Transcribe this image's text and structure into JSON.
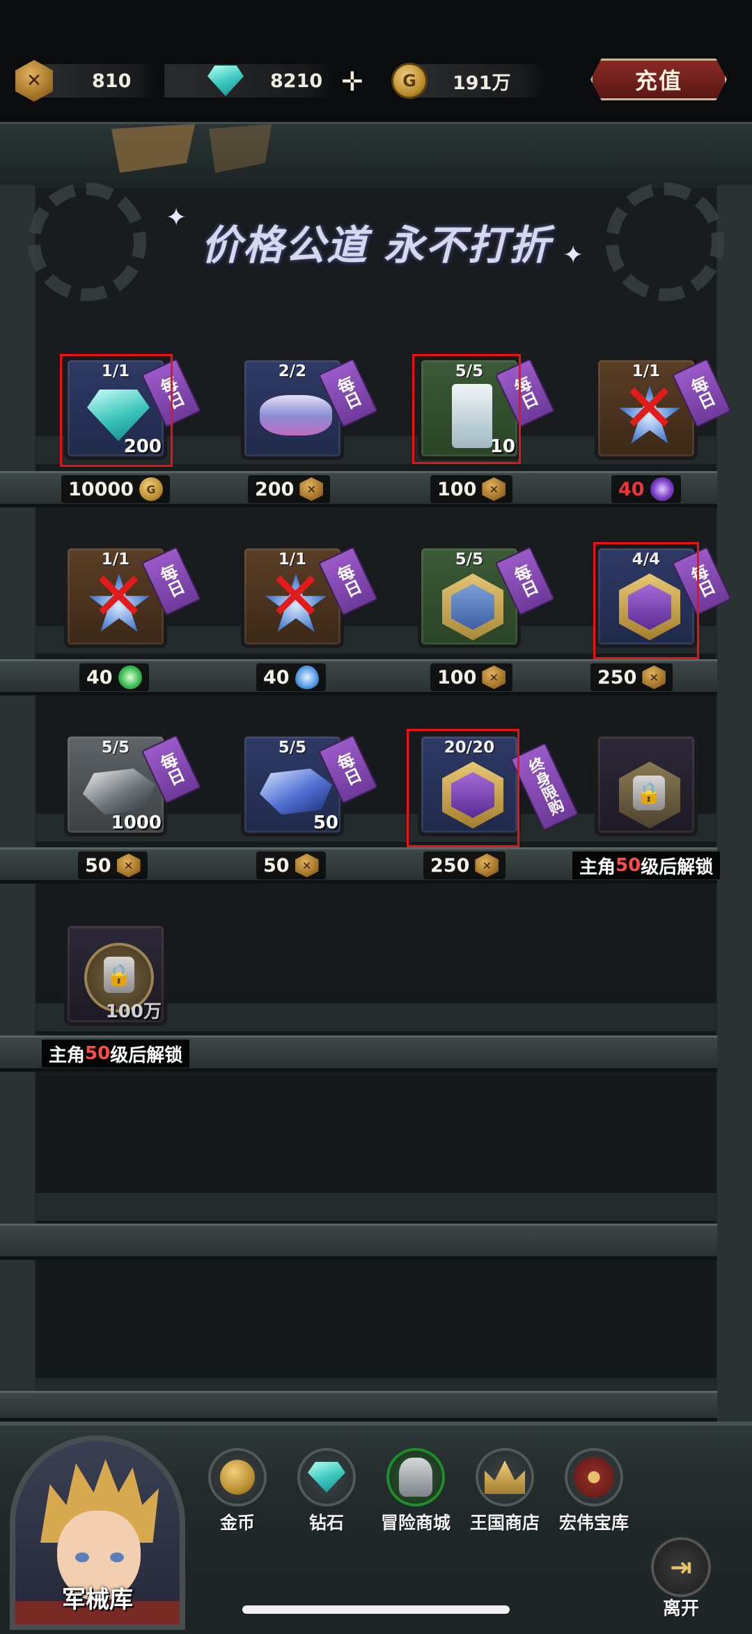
{
  "currencies": {
    "gold_token": {
      "icon": "gold-token-icon",
      "value": "810"
    },
    "diamond": {
      "icon": "diamond-icon",
      "value": "8210"
    },
    "coin": {
      "icon": "coin-icon",
      "value": "191万"
    }
  },
  "recharge_label": "充值",
  "slogan": "价格公道 永不打折",
  "items": [
    {
      "count": "1/1",
      "qty": "200",
      "tag": "每日",
      "icon": "diamond-icon",
      "price": "10000",
      "currency": "coin",
      "crossed": false,
      "highlighted": true,
      "frame": "f-blue"
    },
    {
      "count": "2/2",
      "qty": "",
      "tag": "每日",
      "icon": "mask-icon",
      "price": "200",
      "currency": "gold-token",
      "crossed": false,
      "highlighted": false,
      "frame": "f-blue"
    },
    {
      "count": "5/5",
      "qty": "10",
      "tag": "每日",
      "icon": "scroll-icon",
      "price": "100",
      "currency": "gold-token",
      "crossed": false,
      "highlighted": true,
      "frame": "f-green"
    },
    {
      "count": "1/1",
      "qty": "",
      "tag": "每日",
      "icon": "star-shard-icon",
      "price": "40",
      "currency": "vortex",
      "crossed": true,
      "highlighted": false,
      "frame": "f-brown",
      "price_red": true
    },
    {
      "count": "1/1",
      "qty": "",
      "tag": "每日",
      "icon": "star-shard-icon",
      "price": "40",
      "currency": "leaf",
      "crossed": true,
      "highlighted": false,
      "frame": "f-brown"
    },
    {
      "count": "1/1",
      "qty": "",
      "tag": "每日",
      "icon": "star-shard-icon",
      "price": "40",
      "currency": "drop",
      "crossed": true,
      "highlighted": false,
      "frame": "f-brown"
    },
    {
      "count": "5/5",
      "qty": "",
      "tag": "每日",
      "icon": "blue-emblem-icon",
      "price": "100",
      "currency": "gold-token",
      "crossed": false,
      "highlighted": false,
      "frame": "f-green"
    },
    {
      "count": "4/4",
      "qty": "",
      "tag": "每日",
      "icon": "purple-emblem-icon",
      "price": "250",
      "currency": "gold-token",
      "crossed": false,
      "highlighted": true,
      "frame": "f-blue"
    },
    {
      "count": "5/5",
      "qty": "1000",
      "tag": "每日",
      "icon": "gray-crystal-icon",
      "price": "50",
      "currency": "gold-token",
      "crossed": false,
      "highlighted": false,
      "frame": "f-gray"
    },
    {
      "count": "5/5",
      "qty": "50",
      "tag": "每日",
      "icon": "blue-crystal-icon",
      "price": "50",
      "currency": "gold-token",
      "crossed": false,
      "highlighted": false,
      "frame": "f-blue"
    },
    {
      "count": "20/20",
      "qty": "",
      "tag": "终身限购",
      "icon": "purple-emblem-icon",
      "price": "250",
      "currency": "gold-token",
      "crossed": false,
      "highlighted": true,
      "frame": "f-blue"
    },
    {
      "count": "",
      "qty": "",
      "tag": "",
      "icon": "locked-relic-icon",
      "locked": true,
      "unlock_prefix": "主角",
      "unlock_level": "50",
      "unlock_suffix": "级后解锁",
      "frame": "f-dark"
    },
    {
      "count": "",
      "qty": "100万",
      "tag": "",
      "icon": "lock-icon",
      "locked": true,
      "unlock_prefix": "主角",
      "unlock_level": "50",
      "unlock_suffix": "级后解锁",
      "frame": "f-dark"
    }
  ],
  "nav": [
    {
      "label": "金币",
      "icon": "coin-icon",
      "active": false
    },
    {
      "label": "钻石",
      "icon": "diamond-icon",
      "active": false
    },
    {
      "label": "冒险商城",
      "icon": "helmet-icon",
      "active": true
    },
    {
      "label": "王国商店",
      "icon": "crown-icon",
      "active": false
    },
    {
      "label": "宏伟宝库",
      "icon": "eye-icon",
      "active": false
    }
  ],
  "portrait_label": "军械库",
  "leave_label": "离开"
}
